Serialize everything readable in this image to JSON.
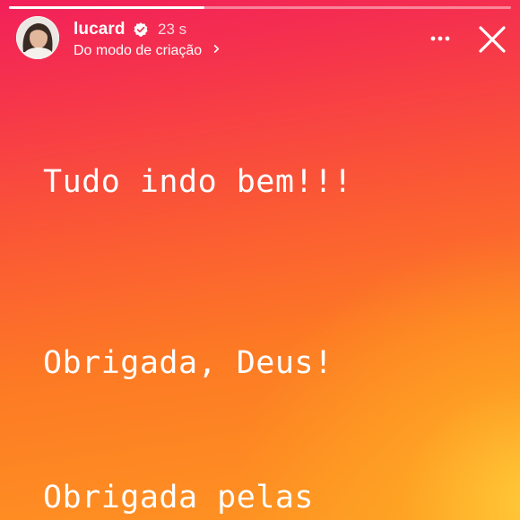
{
  "story": {
    "progress": 0.39,
    "user": {
      "username": "lucard",
      "verified": true,
      "time_ago": "23 s",
      "subtitle": "Do modo de criação"
    },
    "actions": {
      "more_icon": "more-horizontal-icon",
      "close_icon": "close-icon"
    },
    "text_lines": [
      "Tudo indo bem!!!",
      "Obrigada, Deus!",
      "Obrigada pelas"
    ],
    "colors": {
      "gradient_top": "#f2205a",
      "gradient_mid": "#fb5a34",
      "gradient_bottom": "#fe9622",
      "glow": "#ffce3a",
      "text": "#ffffff"
    }
  }
}
